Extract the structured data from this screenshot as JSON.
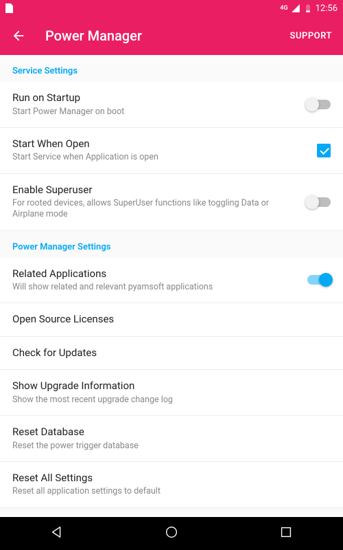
{
  "status": {
    "time": "12:56",
    "network_label": "4G"
  },
  "header": {
    "title": "Power Manager",
    "support": "SUPPORT"
  },
  "sections": {
    "service": "Service Settings",
    "powermgr": "Power Manager Settings"
  },
  "settings": {
    "run_startup": {
      "title": "Run on Startup",
      "sub": "Start Power Manager on boot"
    },
    "start_open": {
      "title": "Start When Open",
      "sub": "Start Service when Application is open"
    },
    "enable_su": {
      "title": "Enable Superuser",
      "sub": "For rooted devices, allows SuperUser functions like toggling Data or Airplane mode"
    },
    "related_apps": {
      "title": "Related Applications",
      "sub": "Will show related and relevant pyamsoft applications"
    },
    "licenses": {
      "title": "Open Source Licenses"
    },
    "check_updates": {
      "title": "Check for Updates"
    },
    "upgrade_info": {
      "title": "Show Upgrade Information",
      "sub": "Show the most recent upgrade change log"
    },
    "reset_db": {
      "title": "Reset Database",
      "sub": "Reset the power trigger database"
    },
    "reset_all": {
      "title": "Reset All Settings",
      "sub": "Reset all application settings to default"
    }
  }
}
